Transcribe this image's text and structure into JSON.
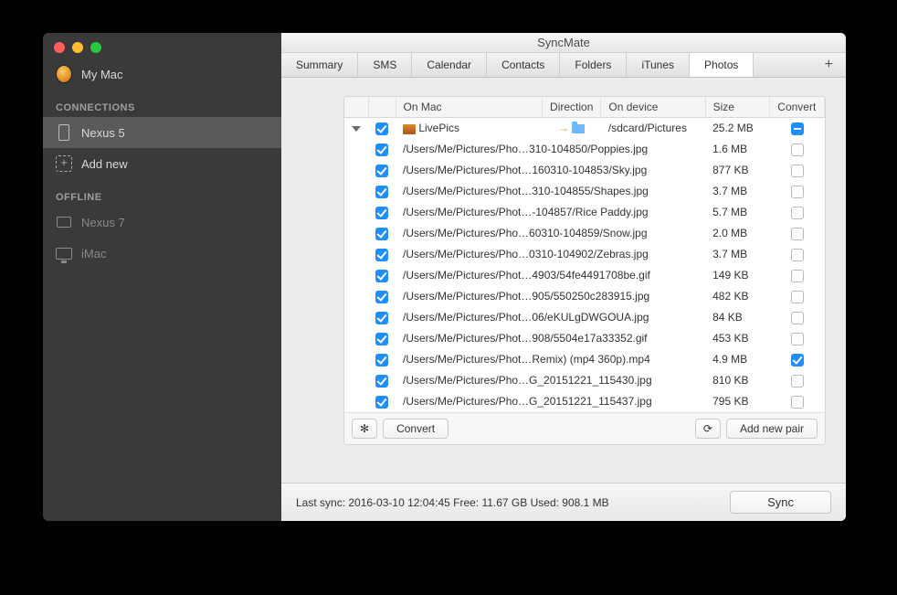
{
  "window": {
    "title": "SyncMate"
  },
  "sidebar": {
    "mymac": "My Mac",
    "header_connections": "CONNECTIONS",
    "header_offline": "OFFLINE",
    "items_connections": [
      "Nexus 5"
    ],
    "add_new": "Add new",
    "items_offline": [
      "Nexus 7",
      "iMac"
    ]
  },
  "tabs": {
    "items": [
      "Summary",
      "SMS",
      "Calendar",
      "Contacts",
      "Folders",
      "iTunes",
      "Photos"
    ],
    "active": 6
  },
  "table": {
    "headers": {
      "onmac": "On Mac",
      "direction": "Direction",
      "ondevice": "On device",
      "size": "Size",
      "convert": "Convert"
    },
    "summary_row": {
      "onmac": "LivePics",
      "ondevice": "/sdcard/Pictures",
      "size": "25.2 MB"
    },
    "rows": [
      {
        "mac": "/Users/Me/Pictures/Pho…310-104850/Poppies.jpg",
        "size": "1.6 MB",
        "conv": false
      },
      {
        "mac": "/Users/Me/Pictures/Phot…160310-104853/Sky.jpg",
        "size": "877 KB",
        "conv": false
      },
      {
        "mac": "/Users/Me/Pictures/Phot…310-104855/Shapes.jpg",
        "size": "3.7 MB",
        "conv": false
      },
      {
        "mac": "/Users/Me/Pictures/Phot…-104857/Rice Paddy.jpg",
        "size": "5.7 MB",
        "conv": false
      },
      {
        "mac": "/Users/Me/Pictures/Pho…60310-104859/Snow.jpg",
        "size": "2.0 MB",
        "conv": false
      },
      {
        "mac": "/Users/Me/Pictures/Pho…0310-104902/Zebras.jpg",
        "size": "3.7 MB",
        "conv": false
      },
      {
        "mac": "/Users/Me/Pictures/Phot…4903/54fe4491708be.gif",
        "size": "149 KB",
        "conv": false
      },
      {
        "mac": "/Users/Me/Pictures/Phot…905/550250c283915.jpg",
        "size": "482 KB",
        "conv": false
      },
      {
        "mac": "/Users/Me/Pictures/Phot…06/eKULgDWGOUA.jpg",
        "size": "84 KB",
        "conv": false
      },
      {
        "mac": "/Users/Me/Pictures/Phot…908/5504e17a33352.gif",
        "size": "453 KB",
        "conv": false
      },
      {
        "mac": "/Users/Me/Pictures/Phot…Remix) (mp4 360p).mp4",
        "size": "4.9 MB",
        "conv": true
      },
      {
        "mac": "/Users/Me/Pictures/Pho…G_20151221_115430.jpg",
        "size": "810 KB",
        "conv": false
      },
      {
        "mac": "/Users/Me/Pictures/Pho…G_20151221_115437.jpg",
        "size": "795 KB",
        "conv": false
      }
    ]
  },
  "toolbar": {
    "convert": "Convert",
    "addpair": "Add new pair"
  },
  "status": {
    "text": "Last sync: 2016-03-10 12:04:45  Free: 11.67 GB  Used: 908.1 MB",
    "sync": "Sync"
  }
}
